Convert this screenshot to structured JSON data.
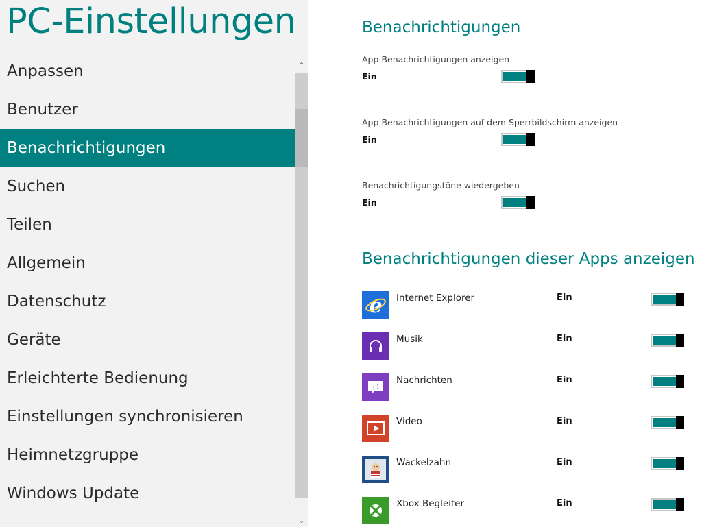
{
  "left": {
    "title": "PC-Einstellungen",
    "nav": [
      {
        "label": "Anpassen"
      },
      {
        "label": "Benutzer"
      },
      {
        "label": "Benachrichtigungen",
        "selected": true
      },
      {
        "label": "Suchen"
      },
      {
        "label": "Teilen"
      },
      {
        "label": "Allgemein"
      },
      {
        "label": "Datenschutz"
      },
      {
        "label": "Geräte"
      },
      {
        "label": "Erleichterte Bedienung"
      },
      {
        "label": "Einstellungen synchronisieren"
      },
      {
        "label": "Heimnetzgruppe"
      },
      {
        "label": "Windows Update"
      }
    ]
  },
  "main": {
    "section1_title": "Benachrichtigungen",
    "settings": [
      {
        "label": "App-Benachrichtigungen anzeigen",
        "state": "Ein",
        "on": true
      },
      {
        "label": "App-Benachrichtigungen auf dem Sperrbildschirm anzeigen",
        "state": "Ein",
        "on": true
      },
      {
        "label": "Benachrichtigungstöne wiedergeben",
        "state": "Ein",
        "on": true
      }
    ],
    "section2_title": "Benachrichtigungen dieser Apps anzeigen",
    "apps": [
      {
        "name": "Internet Explorer",
        "state": "Ein",
        "on": true,
        "icon": "internet-explorer-icon",
        "color": "#1e6fd9"
      },
      {
        "name": "Musik",
        "state": "Ein",
        "on": true,
        "icon": "headphones-icon",
        "color": "#6b2fb3"
      },
      {
        "name": "Nachrichten",
        "state": "Ein",
        "on": true,
        "icon": "messaging-icon",
        "color": "#7d3fbf"
      },
      {
        "name": "Video",
        "state": "Ein",
        "on": true,
        "icon": "video-play-icon",
        "color": "#d2442a"
      },
      {
        "name": "Wackelzahn",
        "state": "Ein",
        "on": true,
        "icon": "wackelzahn-app-icon",
        "color": "#1f4f86"
      },
      {
        "name": "Xbox Begleiter",
        "state": "Ein",
        "on": true,
        "icon": "xbox-icon",
        "color": "#3a9a2a"
      }
    ]
  },
  "colors": {
    "accent": "#008080",
    "sidebar_bg": "#f2f2f2",
    "toggle_knob": "#000000"
  }
}
